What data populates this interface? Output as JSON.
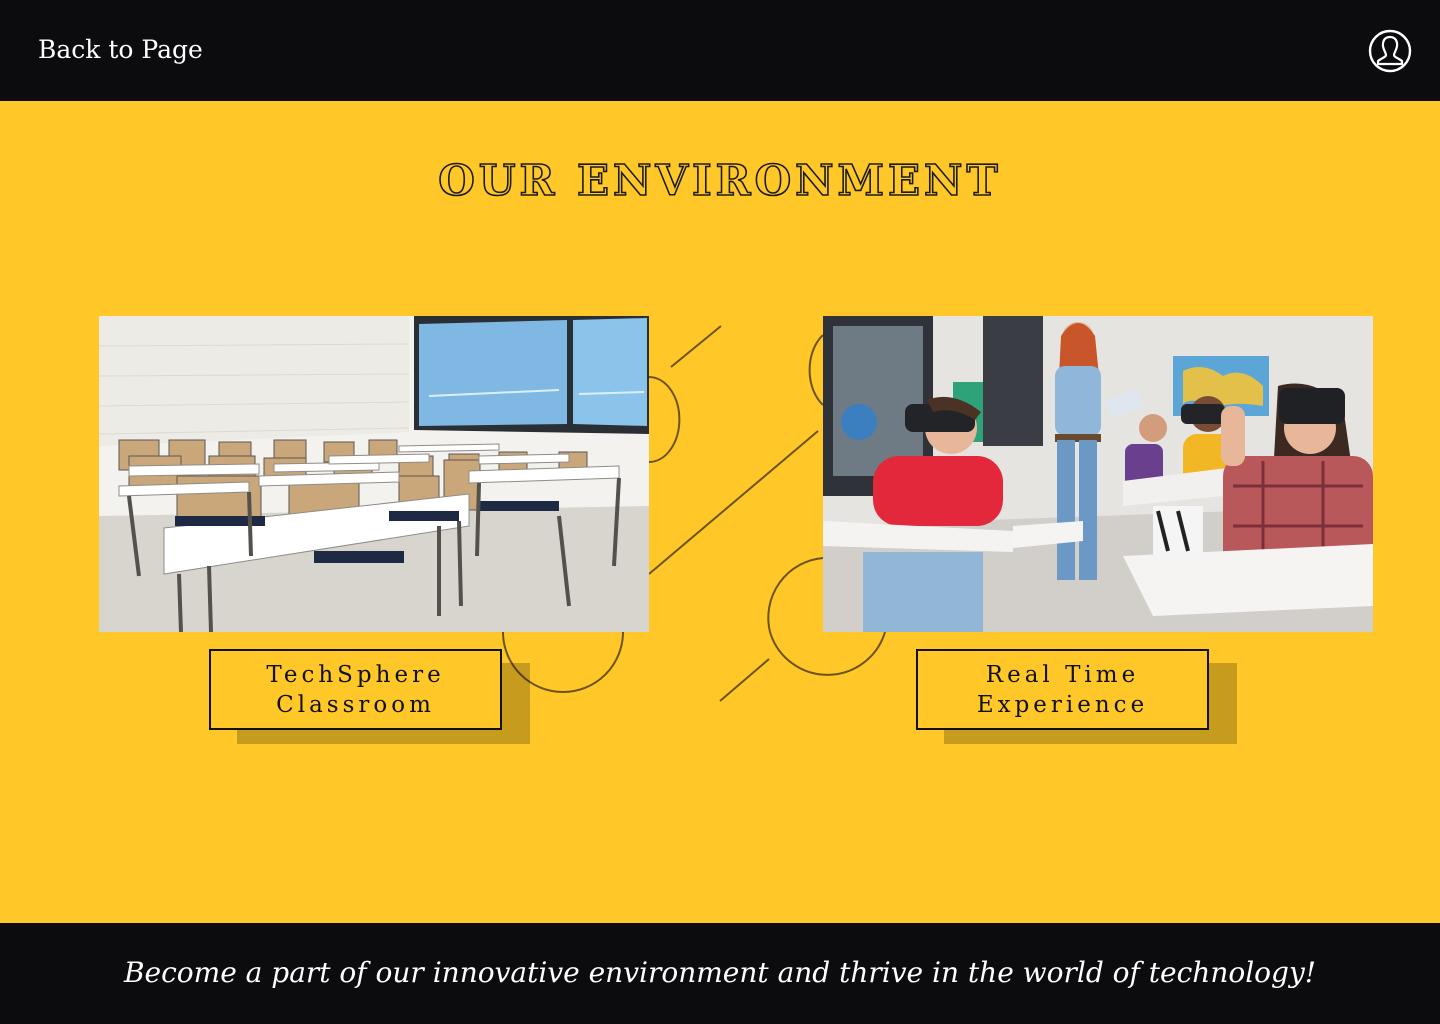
{
  "header": {
    "back_label": "Back to Page",
    "user_icon": "user-icon"
  },
  "main": {
    "title": "OUR ENVIRONMENT",
    "cards": [
      {
        "caption_line1": "TechSphere",
        "caption_line2": "Classroom"
      },
      {
        "caption_line1": "Real Time",
        "caption_line2": "Experience"
      }
    ]
  },
  "footer": {
    "tagline": "Become a part of our innovative environment and thrive in the world of technology!"
  },
  "colors": {
    "background": "#FFC727",
    "bars": "#0C0C0F",
    "text_dark": "#111111",
    "text_light": "#FFFFFF"
  }
}
